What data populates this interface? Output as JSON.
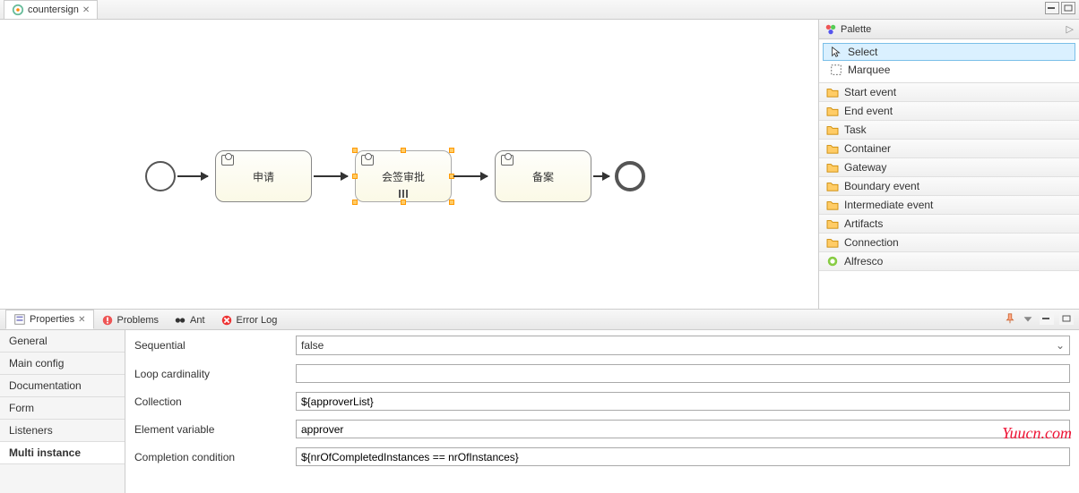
{
  "editor": {
    "tab_title": "countersign"
  },
  "canvas_nodes": {
    "task1": "申请",
    "task2": "会签审批",
    "task3": "备案"
  },
  "palette": {
    "header": "Palette",
    "select": "Select",
    "marquee": "Marquee",
    "drawers": [
      "Start event",
      "End event",
      "Task",
      "Container",
      "Gateway",
      "Boundary event",
      "Intermediate event",
      "Artifacts",
      "Connection",
      "Alfresco"
    ]
  },
  "bottom_tabs": {
    "properties": "Properties",
    "problems": "Problems",
    "ant": "Ant",
    "error_log": "Error Log"
  },
  "props_nav": [
    "General",
    "Main config",
    "Documentation",
    "Form",
    "Listeners",
    "Multi instance"
  ],
  "form": {
    "sequential_label": "Sequential",
    "sequential_value": "false",
    "loop_label": "Loop cardinality",
    "loop_value": "",
    "collection_label": "Collection",
    "collection_value": "${approverList}",
    "element_label": "Element variable",
    "element_value": "approver",
    "completion_label": "Completion condition",
    "completion_value": "${nrOfCompletedInstances == nrOfInstances}"
  },
  "watermark": "Yuucn.com"
}
